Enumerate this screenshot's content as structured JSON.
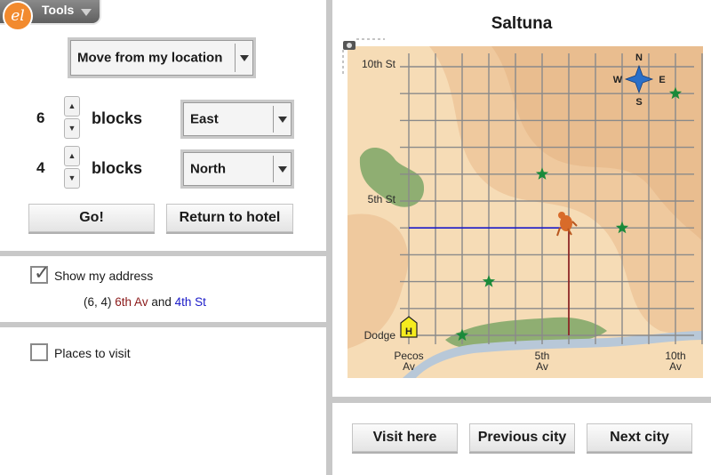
{
  "toolbar": {
    "tools_label": "Tools",
    "logo_text": "el",
    "logo_icon": "explorelearning-logo-icon",
    "dropdown_icon": "caret-down-icon"
  },
  "controls": {
    "move_mode": "Move from my location",
    "step1": {
      "count": "6",
      "unit": "blocks",
      "direction": "East"
    },
    "step2": {
      "count": "4",
      "unit": "blocks",
      "direction": "North"
    },
    "go_label": "Go!",
    "return_label": "Return to hotel"
  },
  "address": {
    "show_label": "Show my address",
    "checked": true,
    "coords": "(6, 4)",
    "avenue": "6th Av",
    "connector": "and",
    "street": "4th St"
  },
  "places": {
    "label": "Places to visit",
    "checked": false
  },
  "map": {
    "city_name": "Saltuna",
    "street_labels": [
      "10th St",
      "5th St",
      "Dodge"
    ],
    "avenue_labels": [
      {
        "name": "Pecos",
        "suffix": "Av"
      },
      {
        "name": "5th",
        "suffix": "Av"
      },
      {
        "name": "10th",
        "suffix": "Av"
      }
    ],
    "compass": {
      "n": "N",
      "s": "S",
      "e": "E",
      "w": "W"
    },
    "hotel_letter": "H",
    "grid": {
      "avenues": 13,
      "streets": 11
    },
    "player": {
      "avenue": 6,
      "street": 4
    },
    "places_to_visit": [
      {
        "avenue": 5,
        "street": 6
      },
      {
        "avenue": 8,
        "street": 4
      },
      {
        "avenue": 3,
        "street": 2
      },
      {
        "avenue": 2,
        "street": 0
      },
      {
        "avenue": 10,
        "street": 9
      }
    ],
    "hotel": {
      "avenue": 0,
      "street": 0
    },
    "colors": {
      "path_east": "#1a1ac8",
      "path_north": "#8b1a1a",
      "star": "#1a8a3a",
      "grid": "#8a8a8a",
      "sand": "#f6dcb6",
      "river": "#b8c8d8",
      "green": "#8fae72",
      "hotel": "#f5ec1e"
    }
  },
  "bottom": {
    "visit_label": "Visit here",
    "previous_label": "Previous city",
    "next_label": "Next city"
  }
}
